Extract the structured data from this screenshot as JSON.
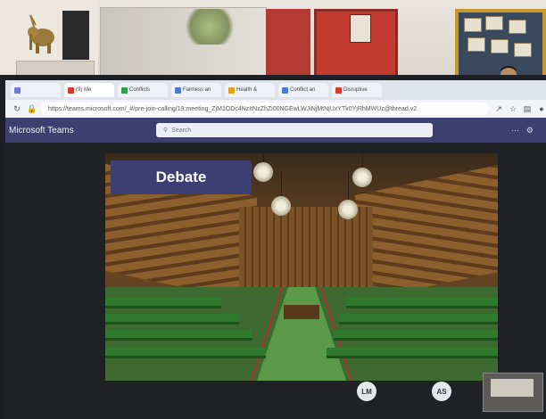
{
  "browser": {
    "tabs": [
      {
        "label": "",
        "color": "#6b7bd6",
        "active": false
      },
      {
        "label": "(9) Me",
        "color": "#d33b2f",
        "active": true
      },
      {
        "label": "Conflicts",
        "color": "#2e9e4a",
        "active": false
      },
      {
        "label": "Fairness an",
        "color": "#4c78d0",
        "active": false
      },
      {
        "label": "Health &",
        "color": "#e3a21a",
        "active": false
      },
      {
        "label": "Conflict an",
        "color": "#4c78d0",
        "active": false
      },
      {
        "label": "Disruptive",
        "color": "#d33b2f",
        "active": false
      }
    ],
    "url": "https://teams.microsoft.com/_#/pre-join-calling/19:meeting_ZjM1ODc4NzItNzZhZi00NGEwLWJiNjMtNjUxYTk0YjRhMWUz@thread.v2"
  },
  "teams": {
    "app_title": "Microsoft Teams",
    "search_placeholder": "Search"
  },
  "slide": {
    "title": "Debate"
  },
  "participants": [
    {
      "initials": "LM"
    },
    {
      "initials": "AS"
    }
  ],
  "colors": {
    "teams_header": "#3d3f6e",
    "slide_title_bg": "#3b3f72",
    "bench_green": "#2f7a2e"
  }
}
